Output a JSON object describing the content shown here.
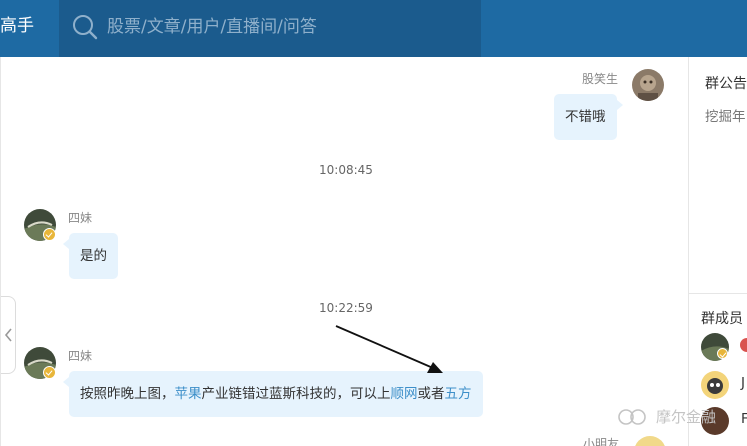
{
  "header": {
    "brand": "高手",
    "search_placeholder": "股票/文章/用户/直播间/问答",
    "search_value": ""
  },
  "chat": {
    "messages": [
      {
        "sender": "股笑生",
        "text": "不错哦"
      },
      {
        "timestamp": "10:08:45"
      },
      {
        "sender": "四妹",
        "text": "是的"
      },
      {
        "timestamp": "10:22:59"
      },
      {
        "sender": "四妹",
        "segments": [
          {
            "text": "按照昨晚上图，",
            "link": false
          },
          {
            "text": "苹果",
            "link": true
          },
          {
            "text": "产业链错过蓝斯科技的，可以上",
            "link": false
          },
          {
            "text": "顺网",
            "link": true
          },
          {
            "text": "或者",
            "link": false
          },
          {
            "text": "五方",
            "link": true
          }
        ]
      },
      {
        "sender": "小明友"
      }
    ]
  },
  "side": {
    "announcement_title": "群公告",
    "announcement_text": "挖掘年",
    "members_title": "群成员",
    "members": [
      {
        "label": ""
      },
      {
        "label": "J"
      },
      {
        "label": "F"
      }
    ]
  },
  "watermark": "摩尔金融",
  "colors": {
    "topbar": "#1e6aa3",
    "search_box": "#1b5b8d",
    "bubble": "#e6f3fd",
    "link": "#3d8fc9"
  }
}
